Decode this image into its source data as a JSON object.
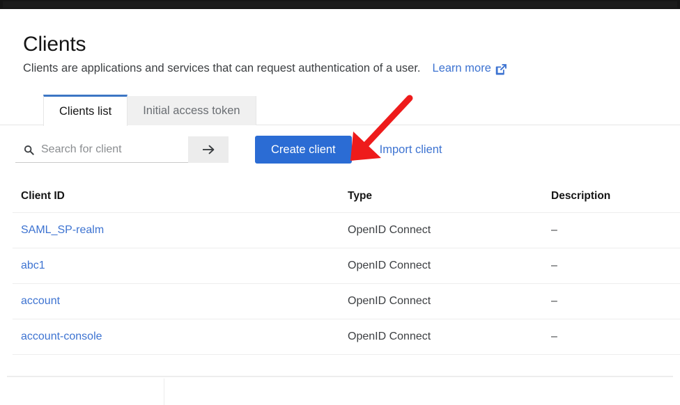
{
  "header": {
    "title": "Clients",
    "subtitle": "Clients are applications and services that can request authentication of a user.",
    "learn_more_label": "Learn more",
    "learn_more_icon": "external-link-icon"
  },
  "tabs": [
    {
      "label": "Clients list",
      "active": true
    },
    {
      "label": "Initial access token",
      "active": false
    }
  ],
  "toolbar": {
    "search_placeholder": "Search for client",
    "search_value": "",
    "search_icon": "search-icon",
    "search_submit_icon": "arrow-right-icon",
    "create_client_label": "Create client",
    "import_client_label": "Import client"
  },
  "table": {
    "columns": [
      "Client ID",
      "Type",
      "Description"
    ],
    "rows": [
      {
        "client_id": "SAML_SP-realm",
        "type": "OpenID Connect",
        "description": "–"
      },
      {
        "client_id": "abc1",
        "type": "OpenID Connect",
        "description": "–"
      },
      {
        "client_id": "account",
        "type": "OpenID Connect",
        "description": "–"
      },
      {
        "client_id": "account-console",
        "type": "OpenID Connect",
        "description": "–"
      }
    ]
  },
  "annotation": {
    "type": "arrow",
    "color": "#ee1b1b",
    "points_to": "create-client-button"
  },
  "colors": {
    "primary_blue": "#2b6cd4",
    "link_blue": "#3d73d1",
    "tab_active_border": "#3c76c4",
    "topbar": "#151515",
    "annotation_red": "#ee1b1b"
  }
}
